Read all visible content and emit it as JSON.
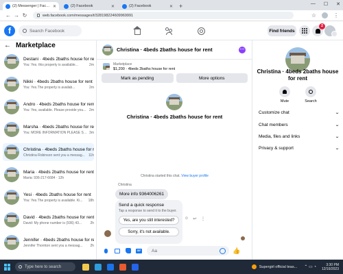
{
  "browser": {
    "tabs": [
      {
        "label": "(2) Messenger | Facebook",
        "active": true
      },
      {
        "label": "(2) Facebook",
        "active": false
      },
      {
        "label": "(2) Facebook",
        "active": false
      }
    ],
    "new_tab": "+",
    "url": "web.facebook.com/messages/t/328198224609969991"
  },
  "header": {
    "logo": "f",
    "search_placeholder": "Search Facebook",
    "find_friends": "Find friends",
    "notif_count": "2"
  },
  "sidebar": {
    "title": "Marketplace",
    "conversations": [
      {
        "title": "Destani · 4beds 2baths house for rent",
        "preview": "You: Yes. this property is available...",
        "time": "2m",
        "active": false
      },
      {
        "title": "Nikki · 4beds 2baths house for rent",
        "preview": "You: Yes.The property is availab...",
        "time": "2m",
        "active": false
      },
      {
        "title": "Andro · 4beds 2baths house for rent",
        "preview": "You: Yes, available. Please provide you...",
        "time": "2m",
        "active": false
      },
      {
        "title": "Marsha · 4beds 2baths house for rent",
        "preview": "You: MORE INFORMATION PLEASE SE...",
        "time": "3m",
        "active": false
      },
      {
        "title": "Christina · 4beds 2baths house for rent",
        "preview": "Christina Robinson sent you a messag...",
        "time": "11h",
        "active": true
      },
      {
        "title": "Maria · 4beds 2baths house for rent",
        "preview": "Maria: 936-217-6684 · 12h",
        "time": "",
        "active": false
      },
      {
        "title": "Yesi · 4beds 2baths house for rent",
        "preview": "You: Yes.The property is available. Ki...",
        "time": "18h",
        "active": false
      },
      {
        "title": "David · 4beds 2baths house for rent",
        "preview": "David: My phone number is (936) 43...",
        "time": "2h",
        "active": false
      },
      {
        "title": "Jennifer · 4beds 2baths house for rent",
        "preview": "Jennifer Thornton sent you a messag...",
        "time": "2h",
        "active": false
      }
    ]
  },
  "chat": {
    "title": "Christina · 4beds 2baths house for rent",
    "marketplace_label": "Marketplace",
    "listing_detail": "$1,200 · 4beds 2baths house for rent",
    "mark_pending": "Mark as pending",
    "more_options": "More options",
    "intro_title": "Christina · 4beds 2baths house for rent",
    "started_text": "Christina started this chat.",
    "view_profile": "View buyer profile",
    "sender_name": "Christina",
    "message": "More info 9364006261",
    "quick_title": "Send a quick response",
    "quick_sub": "Tap a response to send it to the buyer.",
    "quick_replies": [
      "Yes, are you still interested?",
      "Sorry, it's not available."
    ],
    "input_placeholder": "Aa"
  },
  "info": {
    "title": "Christina · 4beds 2baths house for rent",
    "mute": "Mute",
    "search": "Search",
    "sections": [
      "Customize chat",
      "Chat members",
      "Media, files and links",
      "Privacy & support"
    ]
  },
  "taskbar": {
    "search_text": "Type here to search",
    "weather": "Supergirl official teas...",
    "time": "3:30 PM",
    "date": "12/16/2023"
  },
  "colors": {
    "brand": "#1877f2",
    "active_row": "#ebf5ff",
    "badge": "#e41e3f"
  }
}
